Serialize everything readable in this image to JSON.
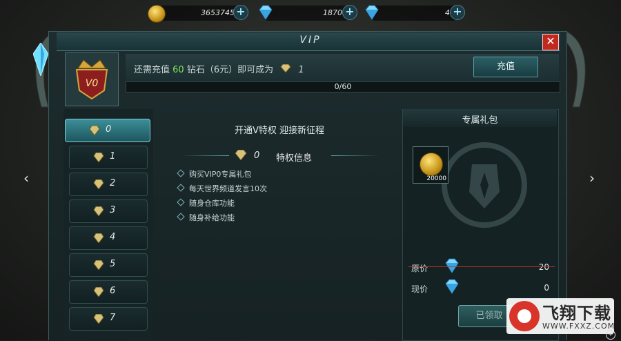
{
  "currency": {
    "gold": "3653745",
    "diamond_bound": "1870",
    "diamond": "4",
    "plus": "+"
  },
  "window": {
    "title": "VIP",
    "close": "✕"
  },
  "header": {
    "text_prefix": "还需充值",
    "amount": "60",
    "text_mid": "钻石（6元）即可成为",
    "target_level": "1",
    "recharge_label": "充值",
    "progress_text": "0/60",
    "progress_fraction": 0,
    "badge_level": "V0"
  },
  "vip_levels": [
    {
      "num": "0",
      "active": true
    },
    {
      "num": "1",
      "active": false
    },
    {
      "num": "2",
      "active": false
    },
    {
      "num": "3",
      "active": false
    },
    {
      "num": "4",
      "active": false
    },
    {
      "num": "5",
      "active": false
    },
    {
      "num": "6",
      "active": false
    },
    {
      "num": "7",
      "active": false
    }
  ],
  "privilege": {
    "title": "开通V特权 迎接新征程",
    "level": "0",
    "label": "特权信息",
    "perks": [
      "购买VIP0专属礼包",
      "每天世界频道发言10次",
      "随身仓库功能",
      "随身补给功能"
    ]
  },
  "gift": {
    "title": "专属礼包",
    "item_count": "20000",
    "original_label": "原价",
    "original_price": "20",
    "current_label": "现价",
    "current_price": "0",
    "claim_label": "已领取"
  },
  "nav": {
    "prev": "‹",
    "next": "›"
  },
  "watermark": {
    "name": "飞翔下载",
    "url": "WWW.FXXZ.COM"
  },
  "colors": {
    "accent": "#4fb3c3",
    "green": "#7ee25b",
    "close": "#c02a1e",
    "gold": "#e0b33a"
  }
}
